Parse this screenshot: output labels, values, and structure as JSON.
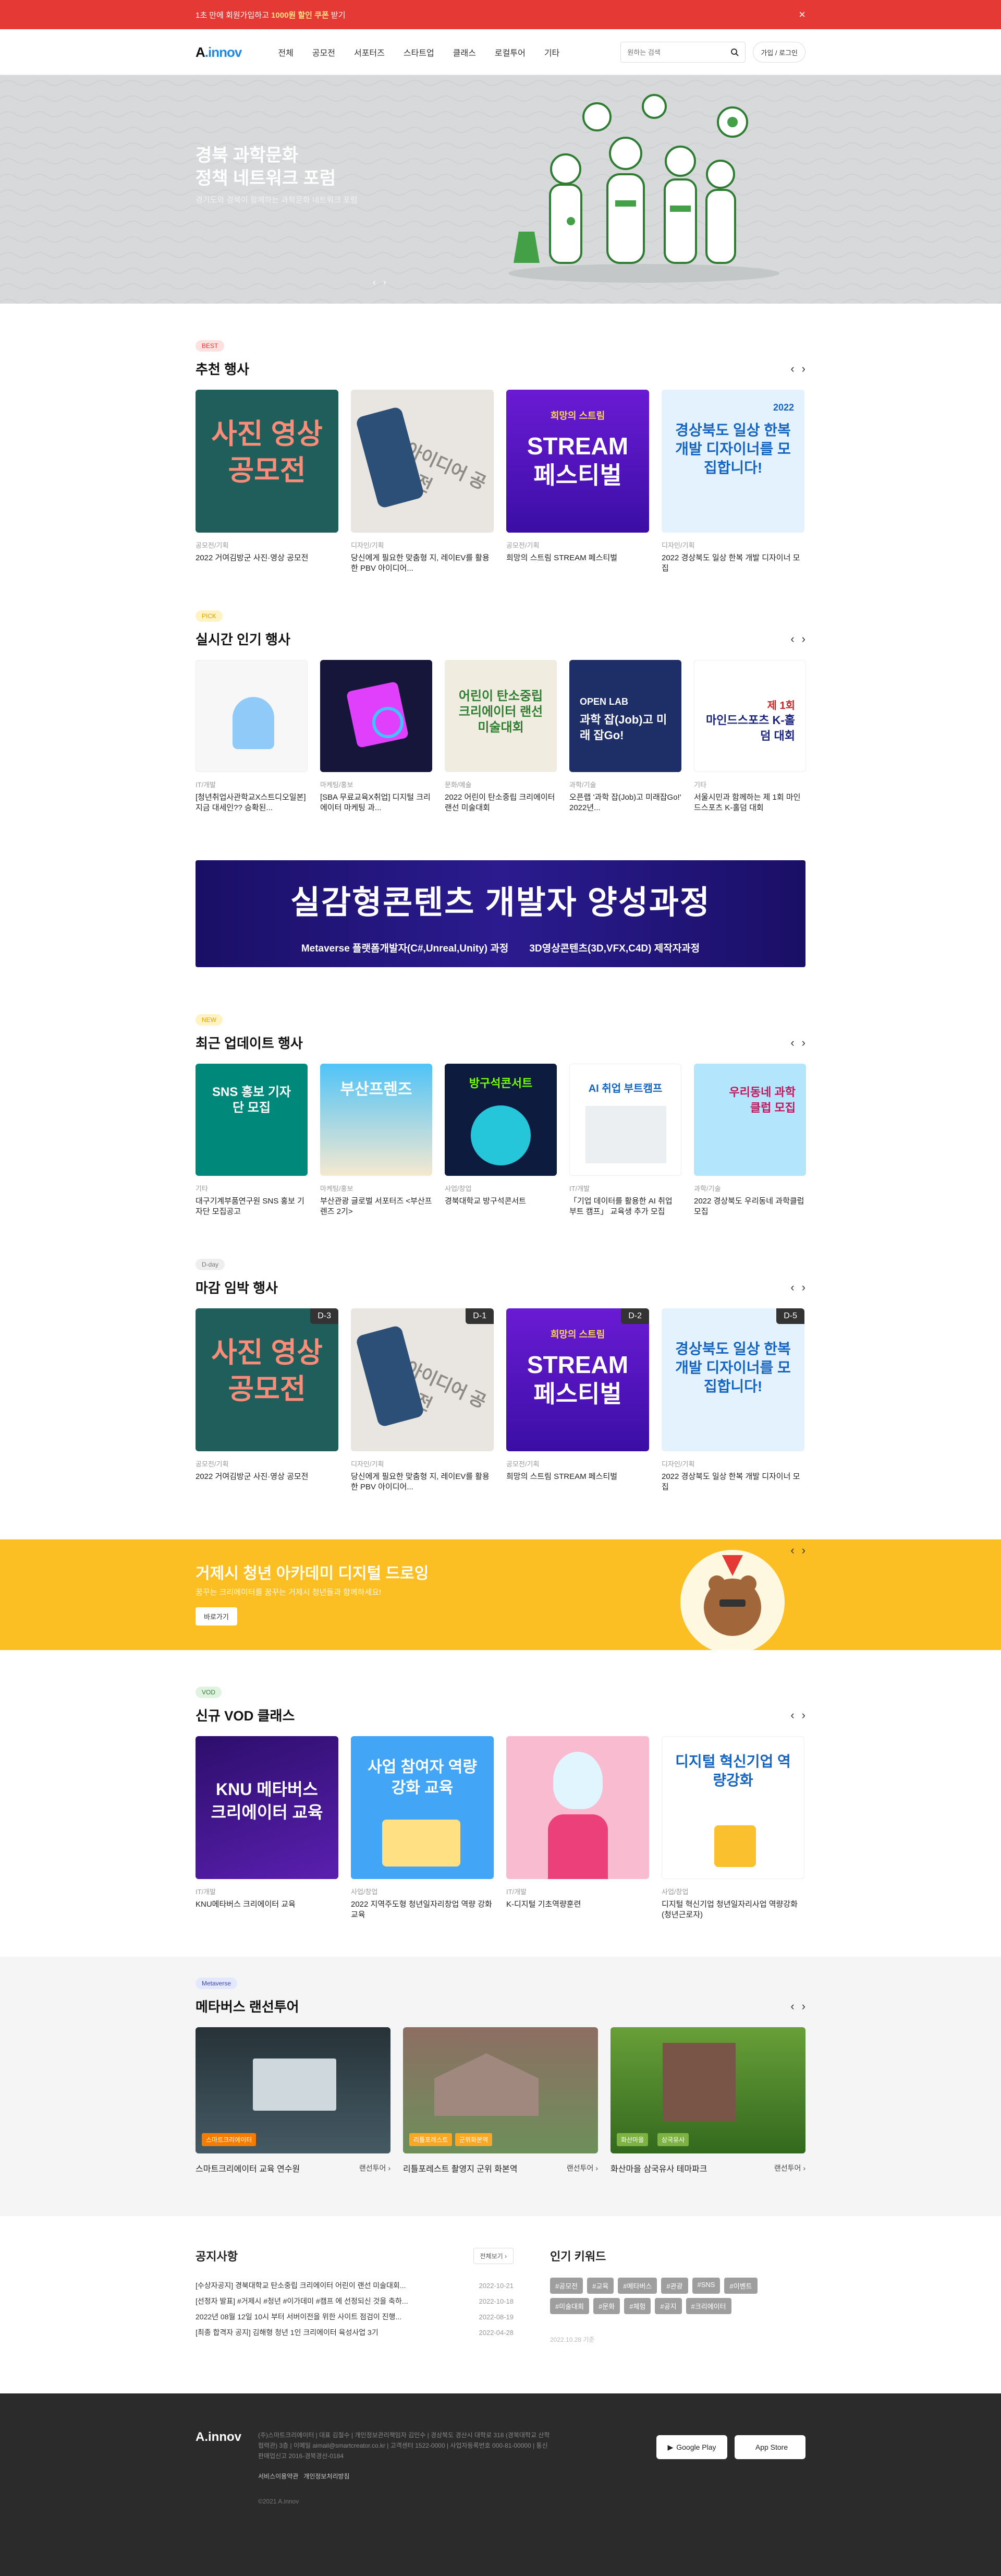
{
  "topbar": {
    "before": "1초 만에 회원가입하고 ",
    "highlight": "1000원 할인 쿠폰",
    "after": " 받기",
    "close": "×"
  },
  "header": {
    "logo_a": "A",
    "logo_b": ".innov",
    "nav": [
      "전체",
      "공모전",
      "서포터즈",
      "스타트업",
      "클래스",
      "로컬투어",
      "기타"
    ],
    "search_placeholder": "원하는 검색",
    "login": "가입 / 로그인"
  },
  "hero": {
    "title_1": "경북 과학문화",
    "title_2": "정책 네트워크 포럼",
    "subtitle": "경기도와 경북이 함께하는 과학문화 네트워크 포럼",
    "prev": "‹",
    "next": "›"
  },
  "best": {
    "tag": "BEST",
    "title": "추천 행사",
    "items": [
      {
        "cat": "공모전/기획",
        "title": "2022 거여김방군 사진·영상 공모전",
        "big": "사진 영상 공모전"
      },
      {
        "cat": "디자인/기획",
        "title": "당신에게 필요한 맞춤형 지, 레이EV를 활용한 PBV 아이디어...",
        "big": "PBV 아이디어 공모전"
      },
      {
        "cat": "공모전/기획",
        "title": "희망의 스트림 STREAM 페스티벌",
        "big": "STREAM 페스티벌",
        "kicker": "희망의 스트림"
      },
      {
        "cat": "디자인/기획",
        "title": "2022 경상북도 일상 한복 개발 디자이너 모집",
        "big": "경상북도 일상 한복 개발 디자이너를 모집합니다!",
        "year": "2022"
      }
    ]
  },
  "pick": {
    "tag": "PICK",
    "title": "실시간 인기 행사",
    "items": [
      {
        "cat": "IT/개발",
        "title": "[청년취업사관학교X스트디오일본] 지금 대세인?? 승확된..."
      },
      {
        "cat": "마케팅/홍보",
        "title": "[SBA 무료교육X취업] 디지털 크리에이터 마케팅 과..."
      },
      {
        "cat": "문화/예술",
        "title": "2022 어린이 탄소중립 크리에이터 랜선 미술대회",
        "big": "어린이 탄소중립 크리에이터 랜선 미술대회"
      },
      {
        "cat": "과학/기술",
        "title": "오픈랩 '과학 잡(Job)고 미래잡Go!' 2022년...",
        "big": "과학 잡(Job)고 미래 잡Go!",
        "kicker": "OPEN LAB"
      },
      {
        "cat": "기타",
        "title": "서울시민과 함께하는 제 1회 마인드스포츠 K-홀덤 대회",
        "big": "마인드스포츠 K-홀덤 대회",
        "kicker": "제 1회"
      }
    ]
  },
  "banner1": {
    "title": "실감형콘텐츠 개발자 양성과정",
    "left": "Metaverse 플랫폼개발자(C#,Unreal,Unity) 과정",
    "right": "3D영상콘텐츠(3D,VFX,C4D) 제작자과정"
  },
  "update": {
    "tag": "NEW",
    "title": "최근 업데이트 행사",
    "items": [
      {
        "cat": "기타",
        "title": "대구기계부품연구원 SNS 홍보 기자단 모집공고",
        "big": "SNS 홍보 기자단 모집"
      },
      {
        "cat": "마케팅/홍보",
        "title": "부산관광 글로벌 서포터즈 <부산프렌즈 2기>",
        "big": "부산프렌즈"
      },
      {
        "cat": "사업/창업",
        "title": "경북대학교 방구석콘서트",
        "big": "방구석콘서트"
      },
      {
        "cat": "IT/개발",
        "title": "「기업 데이터를 활용한 AI 취업 부트 캠프」 교육생 추가 모집",
        "big": "AI 취업 부트캠프"
      },
      {
        "cat": "과학/기술",
        "title": "2022 경상북도 우리동네 과학클럽 모집",
        "big": "우리동네 과학클럽 모집"
      }
    ]
  },
  "dday": {
    "tag": "D-day",
    "title": "마감 임박 행사",
    "items": [
      {
        "badge": "D-3",
        "cat": "공모전/기획",
        "title": "2022 거여김방군 사진·영상 공모전"
      },
      {
        "badge": "D-1",
        "cat": "디자인/기획",
        "title": "당신에게 필요한 맞춤형 지, 레이EV를 활용한 PBV 아이디어..."
      },
      {
        "badge": "D-2",
        "cat": "공모전/기획",
        "title": "희망의 스트림 STREAM 페스티벌"
      },
      {
        "badge": "D-5",
        "cat": "디자인/기획",
        "title": "2022 경상북도 일상 한복 개발 디자이너 모집"
      }
    ]
  },
  "yellow": {
    "title": "거제시 청년 아카데미 디지털 드로잉",
    "sub": "꿈꾸는 크리에이터를 꿈꾸는 거제시 청년들과 함께하세요!",
    "btn": "바로가기"
  },
  "vod": {
    "tag": "VOD",
    "title": "신규 VOD 클래스",
    "items": [
      {
        "cat": "IT/개발",
        "title": "KNU메타버스 크리에이터 교육",
        "big": "KNU 메타버스 크리에이터 교육"
      },
      {
        "cat": "사업/창업",
        "title": "2022 지역주도형 청년일자리창업 역량 강화 교육",
        "big": "사업 참여자 역량강화 교육"
      },
      {
        "cat": "IT/개발",
        "title": "K-디지털 기초역량훈련"
      },
      {
        "cat": "사업/창업",
        "title": "디지털 혁신기업 청년일자리사업 역량강화 (청년근로자)",
        "big": "디지털 혁신기업 역량강화"
      }
    ]
  },
  "meta": {
    "tag": "Metaverse",
    "title": "메타버스 랜선투어",
    "items": [
      {
        "name": "스마트크리에이터 교육 연수원",
        "more": "랜선투어 ›",
        "chips": [
          "스마트크리에이터"
        ]
      },
      {
        "name": "리틀포레스트 촬영지 군위 화본역",
        "more": "랜선투어 ›",
        "chips": [
          "리틀포레스트",
          "군위화본역"
        ]
      },
      {
        "name": "화산마을 삼국유사 테마파크",
        "more": "랜선투어 ›",
        "chips": [
          "화산마을",
          "삼국유사"
        ]
      }
    ]
  },
  "notice": {
    "title": "공지사항",
    "more": "전체보기 ›",
    "rows": [
      {
        "t": "[수상자공지] 경북대학교 탄소중립 크리에이터 어린이 랜선 미술대회...",
        "d": "2022-10-21"
      },
      {
        "t": "[선정자 발표] #거제시 #청년 #이가데미 #캠프 에 선정되신 것을 축하...",
        "d": "2022-10-18"
      },
      {
        "t": "2022년 08월 12일 10시 부터 서버이전을 위한 사이트 점검이 진행...",
        "d": "2022-08-19"
      },
      {
        "t": "[최종 합격자 공지] 김해형 청년 1인 크리에이터 육성사업 3기",
        "d": "2022-04-28"
      }
    ]
  },
  "keywords": {
    "title": "인기 키워드",
    "list": [
      "#공모전",
      "#교육",
      "#메타버스",
      "#관광",
      "#SNS",
      "#이벤트",
      "#미술대회",
      "#문화",
      "#체험",
      "#공지",
      "#크리에이터"
    ],
    "date": "2022.10.28 기준"
  },
  "footer": {
    "logo": "A.innov",
    "info": "(주)스마트크리에이터 | 대표 김철수 | 개인정보관리책임자 김민수 | 경상북도 경산시 대학로 318 (경북대학교 산학협력관) 3층 | 이메일 aimail@smartcreator.co.kr | 고객센터 1522-0000 | 사업자등록번호 000-81-00000 | 통신판매업신고 2016-경북경산-0184",
    "links": [
      "서비스이용약관",
      "개인정보처리방침"
    ],
    "copy": "©2021 A.innov",
    "google": "Google Play",
    "apple": "App Store"
  },
  "colors": {
    "topbar": "#e53935",
    "brand": "#1e88e5",
    "yellow": "#fbbf24",
    "banner": "#1a0f66"
  }
}
